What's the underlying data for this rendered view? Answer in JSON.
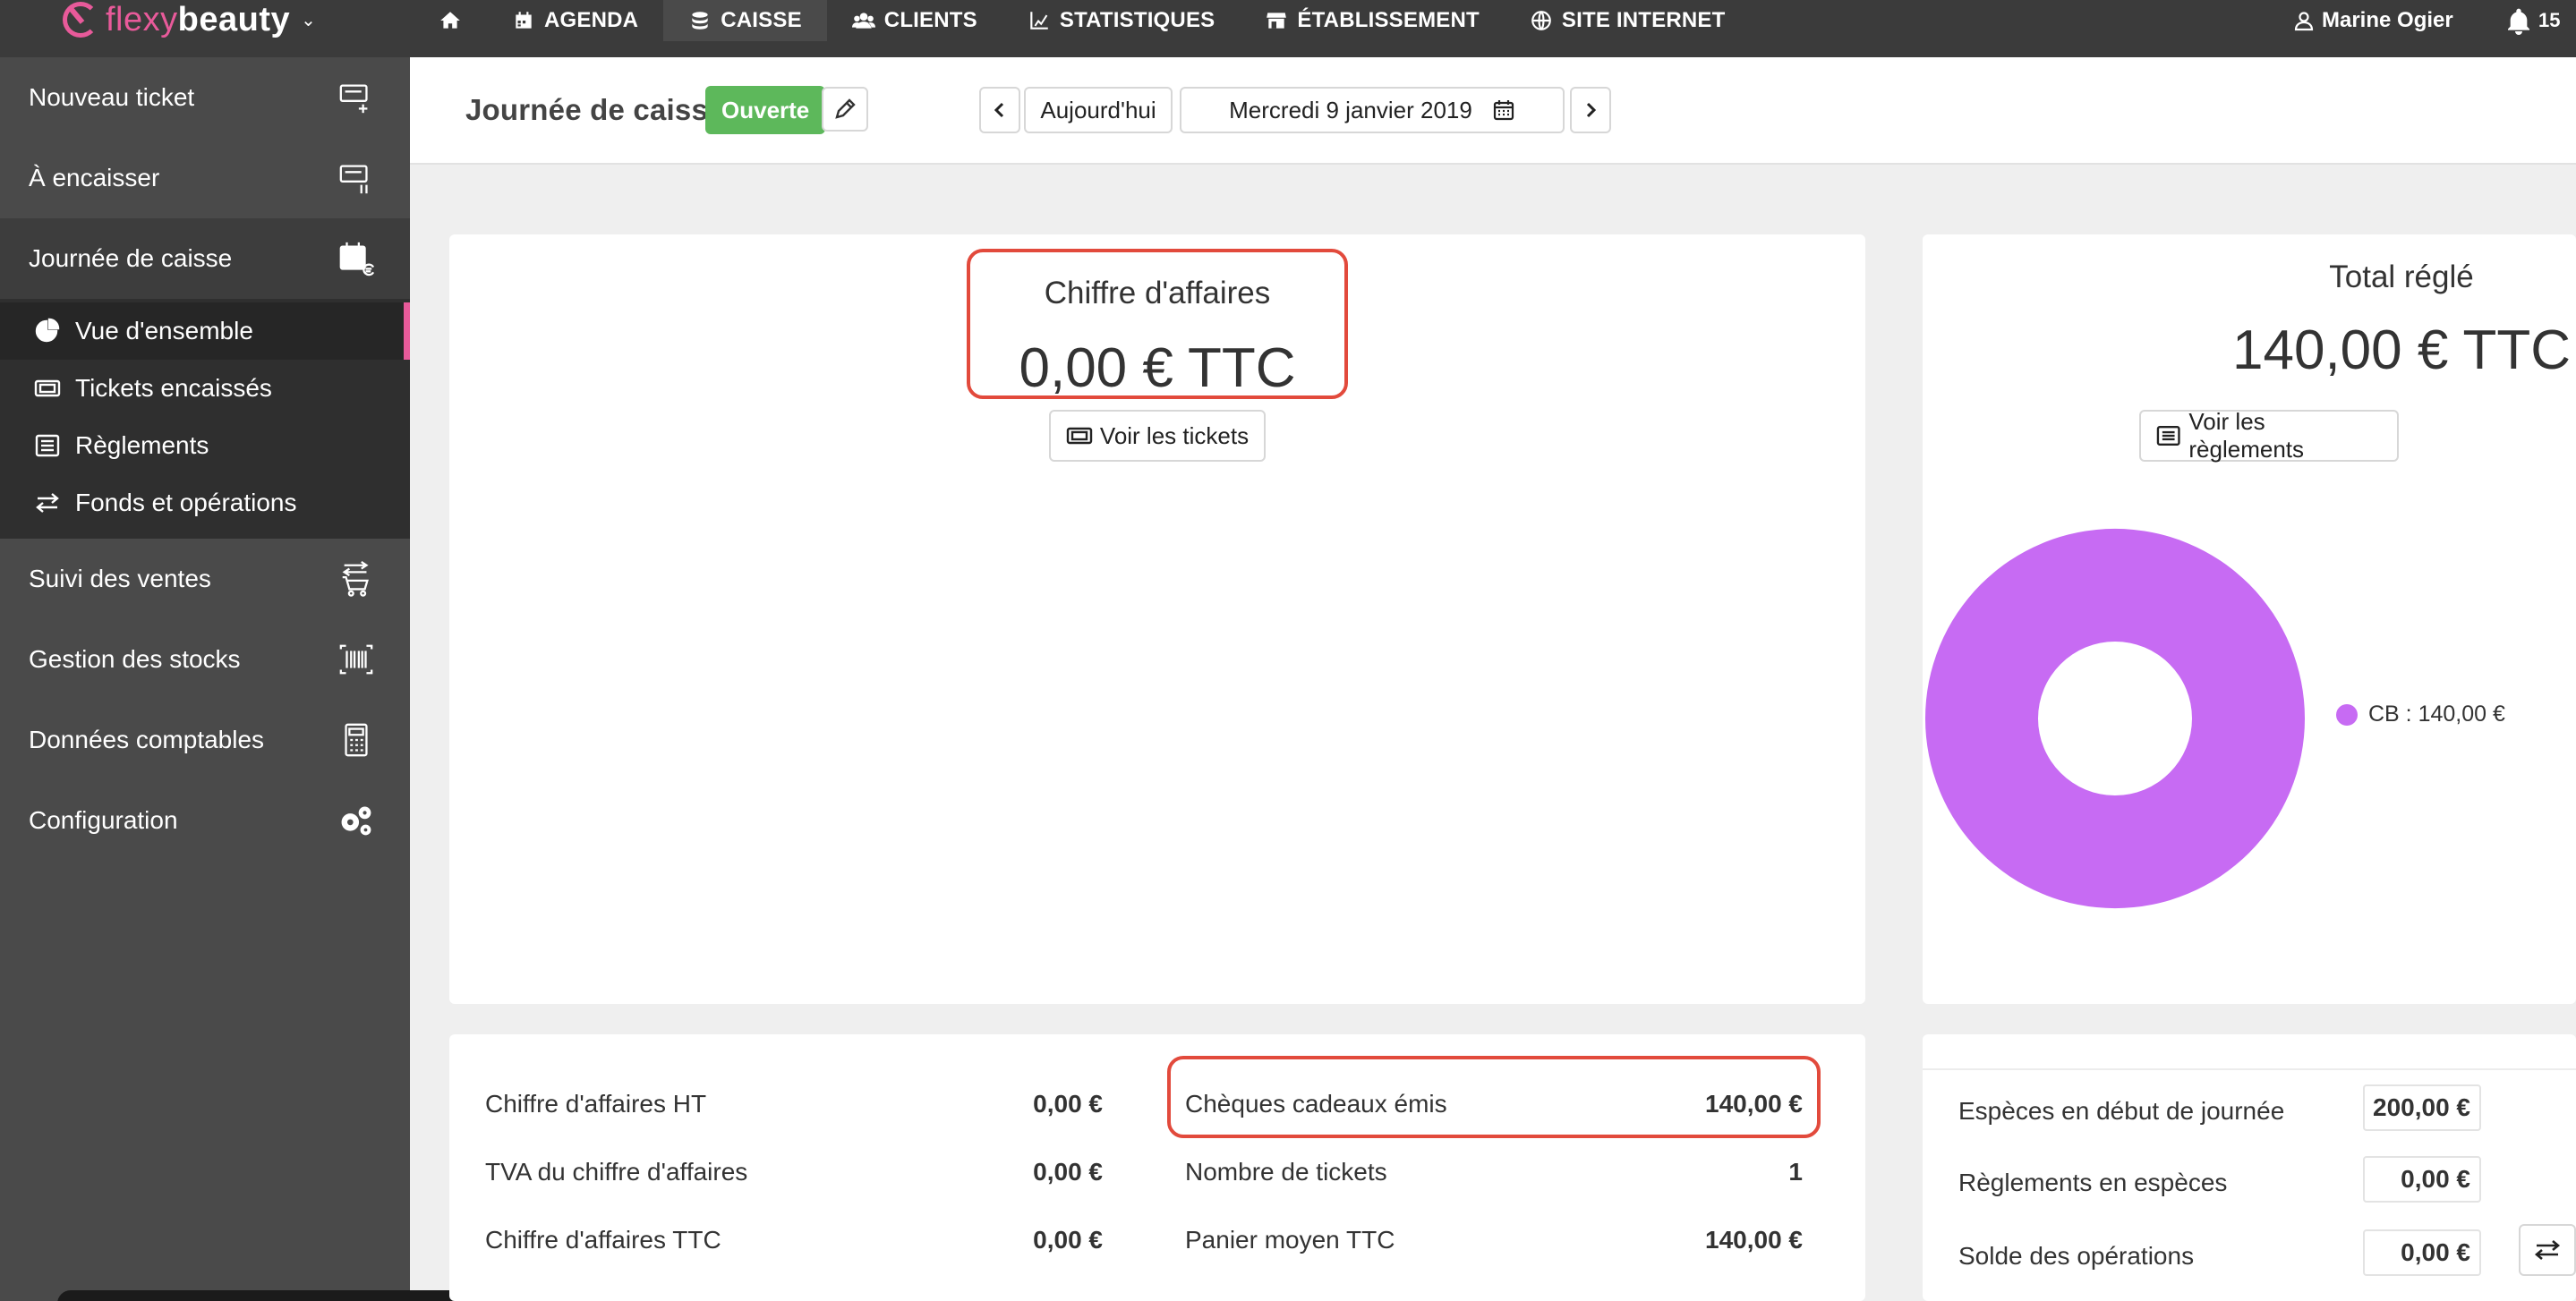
{
  "brand": {
    "name_part1": "flexy",
    "name_part2": "beauty"
  },
  "nav": {
    "items": [
      {
        "label": "AGENDA"
      },
      {
        "label": "CAISSE"
      },
      {
        "label": "CLIENTS"
      },
      {
        "label": "STATISTIQUES"
      },
      {
        "label": "ÉTABLISSEMENT"
      },
      {
        "label": "SITE INTERNET"
      }
    ],
    "user": "Marine Ogier",
    "notifications": "15"
  },
  "sidebar": {
    "items": [
      {
        "label": "Nouveau ticket"
      },
      {
        "label": "À encaisser"
      },
      {
        "label": "Journée de caisse"
      },
      {
        "label": "Suivi des ventes"
      },
      {
        "label": "Gestion des stocks"
      },
      {
        "label": "Données comptables"
      },
      {
        "label": "Configuration"
      }
    ],
    "sub_items": [
      {
        "label": "Vue d'ensemble"
      },
      {
        "label": "Tickets encaissés"
      },
      {
        "label": "Règlements"
      },
      {
        "label": "Fonds et opérations"
      }
    ]
  },
  "header": {
    "title": "Journée de caisse",
    "status": "Ouverte",
    "today": "Aujourd'hui",
    "date": "Mercredi 9 janvier 2019"
  },
  "chiffre_affaires": {
    "title": "Chiffre d'affaires",
    "value": "0,00 € TTC",
    "button": "Voir les tickets"
  },
  "total_regle": {
    "title": "Total réglé",
    "value": "140,00 € TTC",
    "button": "Voir les règlements",
    "legend": "CB : 140,00 €",
    "slice_color": "#c76bf3"
  },
  "chart_data": {
    "type": "pie",
    "categories": [
      "CB"
    ],
    "values": [
      140.0
    ],
    "title": "",
    "xlabel": "",
    "ylabel": ""
  },
  "stats": {
    "left": [
      {
        "label": "Chiffre d'affaires HT",
        "value": "0,00 €"
      },
      {
        "label": "TVA du chiffre d'affaires",
        "value": "0,00 €"
      },
      {
        "label": "Chiffre d'affaires TTC",
        "value": "0,00 €"
      }
    ],
    "right": [
      {
        "label": "Chèques cadeaux émis",
        "value": "140,00 €"
      },
      {
        "label": "Nombre de tickets",
        "value": "1"
      },
      {
        "label": "Panier moyen TTC",
        "value": "140,00 €"
      }
    ]
  },
  "fonds": [
    {
      "label": "Espèces en début de journée",
      "value": "200,00 €"
    },
    {
      "label": "Règlements en espèces",
      "value": "0,00 €"
    },
    {
      "label": "Solde des opérations",
      "value": "0,00 €"
    }
  ],
  "colors": {
    "accent": "#e85a9a",
    "status_green": "#5db85b",
    "highlight_red": "#e24a3c",
    "topbar": "#3b3b3b",
    "sidebar": "#4a4a4a"
  }
}
